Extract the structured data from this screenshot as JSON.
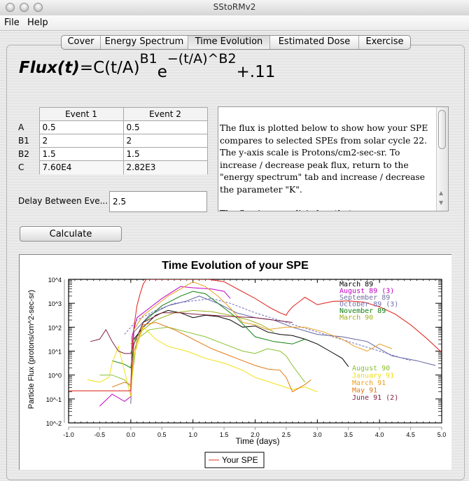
{
  "window": {
    "title": "SStoRMv2"
  },
  "menu": {
    "items": [
      "File",
      "Help"
    ]
  },
  "tabs": [
    {
      "label": "Cover",
      "selected": false
    },
    {
      "label": "Energy Spectrum",
      "selected": false
    },
    {
      "label": "Time Evolution",
      "selected": true
    },
    {
      "label": "Estimated Dose",
      "selected": false
    },
    {
      "label": "Exercise",
      "selected": false
    }
  ],
  "formula": {
    "lhs": "Flux(t)",
    "eq": "=C(t/A)",
    "exp1": "B1",
    "e": "e",
    "exp2": "−(t/A)^B2",
    "tail": "+.11"
  },
  "params_table": {
    "columns": [
      "Event 1",
      "Event 2"
    ],
    "rows": [
      {
        "label": "A",
        "values": [
          "0.5",
          "0.5"
        ],
        "editable": true
      },
      {
        "label": "B1",
        "values": [
          "2",
          "2"
        ],
        "editable": true
      },
      {
        "label": "B2",
        "values": [
          "1.5",
          "1.5"
        ],
        "editable": true
      },
      {
        "label": "C",
        "values": [
          "7.60E4",
          "2.82E3"
        ],
        "editable": false
      }
    ]
  },
  "delay": {
    "label": "Delay Between Eve...",
    "value": "2.5"
  },
  "description": {
    "paragraphs": [
      "The flux is plotted below to show how your SPE compares to selected SPEs from solar cycle 22. The y-axis scale is Protons/cm2-sec-sr. To increase / decrease peak flux, return to the \"energy spectrum\" tab and increase / decrease the parameter \"K\".",
      "The flux is normalizied so that:"
    ]
  },
  "calculate_button": {
    "label": "Calculate"
  },
  "colors": {
    "your_spe": "#e0302a"
  },
  "chart_data": {
    "type": "line",
    "title": "Time Evolution of your SPE",
    "xlabel": "Time (days)",
    "ylabel": "Particle Flux (protons/cm^2-sec-sr)",
    "xlim": [
      -1.0,
      5.0
    ],
    "ylim_log10": [
      -2,
      4
    ],
    "yscale": "log",
    "x_ticks": [
      "-1.0",
      "-0.5",
      "0.0",
      "0.5",
      "1.0",
      "1.5",
      "2.0",
      "2.5",
      "3.0",
      "3.5",
      "4.0",
      "4.5",
      "5.0"
    ],
    "y_ticks": [
      "10^4",
      "10^3",
      "10^2",
      "10^1",
      "10^0",
      "10^-1",
      "10^-2"
    ],
    "legend": {
      "placement": "bottom-center",
      "entries": [
        "Your SPE"
      ]
    },
    "annotations_top": [
      {
        "text": "March 89",
        "color": "#000000"
      },
      {
        "text": "August 89 (3)",
        "color": "#c000c0"
      },
      {
        "text": "September 89",
        "color": "#7070a0"
      },
      {
        "text": "October 89  (3)",
        "color": "#7070b0"
      },
      {
        "text": "November 89",
        "color": "#108010"
      },
      {
        "text": "March 90",
        "color": "#a0b020"
      }
    ],
    "annotations_bottom": [
      {
        "text": "August 90",
        "color": "#88c030"
      },
      {
        "text": "January 91",
        "color": "#f0e010"
      },
      {
        "text": "March 91",
        "color": "#e8a020"
      },
      {
        "text": "May 91",
        "color": "#e07810"
      },
      {
        "text": "June 91 (2)",
        "color": "#802040"
      }
    ],
    "series": [
      {
        "name": "Your SPE",
        "color": "#e0302a",
        "x": [
          -1.0,
          -0.01,
          0.0,
          0.02,
          0.05,
          0.1,
          0.15,
          0.2,
          0.25,
          0.3,
          0.5,
          0.75,
          1.0,
          1.25,
          1.5,
          1.75,
          2.0,
          2.25,
          2.4,
          2.5,
          2.52,
          2.55,
          2.6,
          2.7,
          2.8,
          3.0,
          3.25,
          3.5,
          3.75,
          4.0,
          4.25,
          4.5,
          4.75,
          5.0
        ],
        "log10y": [
          -0.66,
          -0.66,
          -0.6,
          1.0,
          2.0,
          2.9,
          3.4,
          3.8,
          4.0,
          4.0,
          4.0,
          4.0,
          4.0,
          4.0,
          3.9,
          3.55,
          3.2,
          2.8,
          2.6,
          2.5,
          2.6,
          2.7,
          2.85,
          3.05,
          3.25,
          2.94,
          3.08,
          3.1,
          3.05,
          2.85,
          2.55,
          2.1,
          1.55,
          0.95
        ]
      },
      {
        "name": "March 89",
        "color": "#000000",
        "x": [
          0.05,
          0.2,
          0.4,
          0.6,
          0.8,
          1.0,
          1.2,
          1.4,
          1.6,
          1.8,
          2.0,
          2.2,
          2.4,
          2.6,
          2.8,
          3.0,
          3.2,
          3.4,
          3.5
        ],
        "log10y": [
          1.5,
          2.0,
          2.5,
          2.7,
          2.6,
          2.4,
          2.5,
          2.45,
          2.3,
          2.0,
          2.05,
          1.8,
          1.7,
          1.65,
          1.5,
          1.3,
          1.0,
          0.7,
          0.35
        ]
      },
      {
        "name": "August 89 (3)",
        "color": "#c000c0",
        "x": [
          -0.5,
          -0.3,
          -0.1,
          0.0,
          0.02,
          0.1,
          0.3,
          0.5,
          0.8,
          1.0,
          1.3,
          1.5,
          1.6
        ],
        "log10y": [
          -1.3,
          -0.8,
          -1.1,
          -0.9,
          1.6,
          2.4,
          2.8,
          3.2,
          3.7,
          3.65,
          3.6,
          3.5,
          3.2
        ]
      },
      {
        "name": "September 89",
        "color": "#6060a0",
        "x": [
          0.0,
          0.05,
          0.3,
          0.6,
          0.9,
          1.1,
          1.4,
          1.7,
          2.0,
          2.3,
          2.6,
          3.0,
          3.4,
          3.8,
          4.2,
          4.6,
          4.9
        ],
        "log10y": [
          -1.2,
          1.8,
          2.5,
          2.9,
          3.1,
          3.3,
          3.0,
          2.6,
          2.4,
          2.3,
          2.0,
          1.7,
          1.6,
          1.4,
          0.8,
          0.6,
          0.4
        ]
      },
      {
        "name": "October 89 (3)",
        "color": "#7070c0",
        "dashed": true,
        "x": [
          -0.1,
          0.1,
          0.4,
          0.7,
          1.0,
          1.3,
          1.6,
          2.0,
          2.5,
          3.0,
          3.5,
          4.0,
          4.5
        ],
        "log10y": [
          1.7,
          2.3,
          2.7,
          3.0,
          3.1,
          3.2,
          3.0,
          2.6,
          2.2,
          1.8,
          1.4,
          1.0,
          0.6
        ]
      },
      {
        "name": "November 89",
        "color": "#108010",
        "x": [
          -0.3,
          -0.1,
          0.0,
          0.05,
          0.2,
          0.5,
          0.8,
          1.0,
          1.2,
          1.5,
          1.7,
          2.0,
          2.3,
          2.6,
          2.8
        ],
        "log10y": [
          0.6,
          0.45,
          0.3,
          1.3,
          2.2,
          2.9,
          3.3,
          3.5,
          3.4,
          2.8,
          2.4,
          1.6,
          1.4,
          1.3,
          1.5
        ]
      },
      {
        "name": "March 90",
        "color": "#a0b020",
        "x": [
          0.0,
          0.2,
          0.4,
          0.7,
          1.0,
          1.3,
          1.6,
          1.9,
          2.1,
          2.3
        ],
        "log10y": [
          1.3,
          1.9,
          2.3,
          2.6,
          2.7,
          2.65,
          2.5,
          2.3,
          2.1,
          1.8
        ]
      },
      {
        "name": "August 90",
        "color": "#88c030",
        "x": [
          -0.5,
          -0.3,
          -0.1,
          0.0,
          0.1,
          0.3,
          0.6,
          0.9,
          1.2,
          1.5,
          1.8,
          2.0,
          2.2,
          2.4,
          2.5,
          2.6,
          2.8
        ],
        "log10y": [
          0.0,
          0.0,
          -0.2,
          -0.5,
          1.5,
          1.9,
          2.0,
          1.8,
          1.6,
          1.3,
          1.0,
          0.9,
          1.1,
          1.0,
          0.8,
          0.4,
          -0.3
        ]
      },
      {
        "name": "January 91",
        "color": "#f0e010",
        "x": [
          -0.7,
          -0.5,
          -0.35,
          -0.3,
          -0.2,
          0.0,
          0.05,
          0.2,
          0.4,
          0.6,
          0.9,
          1.2,
          1.5,
          1.8,
          2.0,
          2.3,
          2.6,
          2.8,
          3.0
        ],
        "log10y": [
          -0.2,
          -0.3,
          -0.1,
          0.5,
          1.2,
          -0.9,
          0.8,
          2.0,
          1.5,
          1.2,
          1.0,
          0.7,
          0.5,
          0.2,
          -0.1,
          -0.35,
          -0.6,
          -0.5,
          -0.7
        ]
      },
      {
        "name": "March 91",
        "color": "#e8a020",
        "x": [
          0.05,
          0.2,
          0.4,
          0.6,
          0.8,
          1.0,
          1.2,
          1.4,
          1.6,
          1.8,
          2.0,
          2.2,
          2.5,
          2.8,
          3.1,
          3.4,
          3.6,
          3.8,
          4.0,
          4.2
        ],
        "log10y": [
          1.9,
          2.5,
          2.9,
          3.3,
          3.6,
          3.9,
          3.7,
          3.3,
          2.8,
          2.2,
          2.1,
          1.9,
          2.0,
          2.0,
          1.8,
          1.5,
          1.2,
          1.0,
          1.3,
          1.1
        ]
      },
      {
        "name": "May 91",
        "color": "#e07810",
        "x": [
          -0.3,
          -0.1,
          0.0,
          0.05,
          0.2,
          0.4,
          0.7,
          1.0,
          1.3,
          1.5,
          1.8,
          2.0,
          2.2,
          2.4,
          2.5,
          2.6,
          2.8,
          2.9
        ],
        "log10y": [
          -0.5,
          -0.3,
          -0.4,
          1.0,
          2.1,
          2.2,
          1.9,
          1.5,
          1.1,
          0.9,
          0.6,
          0.4,
          0.25,
          0.2,
          -0.1,
          -0.7,
          -0.4,
          -0.2
        ]
      },
      {
        "name": "June 91 (2)",
        "color": "#802040",
        "x": [
          -0.65,
          -0.5,
          -0.4,
          -0.3,
          -0.2,
          -0.1,
          0.0,
          0.05,
          0.2,
          0.5,
          0.8,
          1.0,
          1.3,
          1.6,
          2.0,
          2.3,
          2.6
        ],
        "log10y": [
          1.4,
          1.5,
          1.9,
          1.4,
          1.0,
          0.9,
          0.9,
          1.3,
          2.2,
          2.6,
          2.6,
          2.55,
          2.5,
          2.45,
          2.4,
          2.3,
          2.2
        ]
      }
    ]
  }
}
